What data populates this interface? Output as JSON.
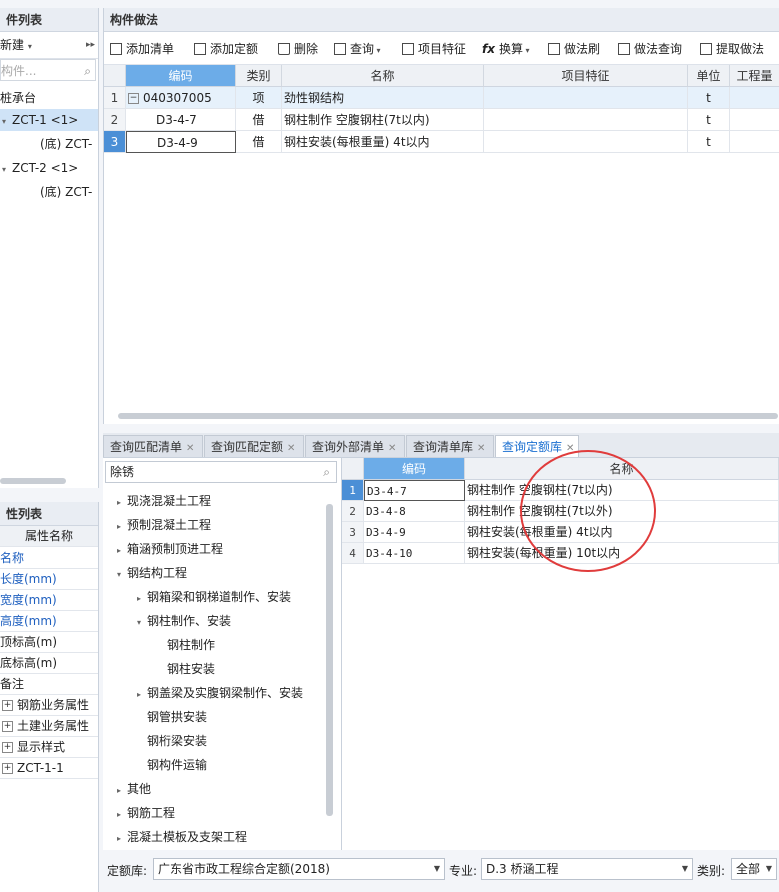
{
  "left_top": {
    "title": "件列表",
    "new_label": "新建",
    "search_placeholder": "构件...",
    "tree": [
      "桩承台",
      "ZCT-1 <1>",
      "(底) ZCT-",
      "ZCT-2 <1>",
      "(底) ZCT-"
    ]
  },
  "left_bottom": {
    "title": "性列表",
    "header": "属性名称",
    "rows": [
      {
        "label": "名称"
      },
      {
        "label": "长度(mm)"
      },
      {
        "label": "宽度(mm)"
      },
      {
        "label": "高度(mm)"
      },
      {
        "label": "顶标高(m)"
      },
      {
        "label": "底标高(m)"
      },
      {
        "label": "备注"
      },
      {
        "label": "钢筋业务属性"
      },
      {
        "label": "土建业务属性"
      },
      {
        "label": "显示样式"
      },
      {
        "label": "ZCT-1-1"
      }
    ]
  },
  "main": {
    "title": "构件做法",
    "toolbar": [
      "添加清单",
      "添加定额",
      "删除",
      "查询",
      "项目特征",
      "换算",
      "做法刷",
      "做法查询",
      "提取做法"
    ],
    "columns": [
      "编码",
      "类别",
      "名称",
      "项目特征",
      "单位",
      "工程量"
    ],
    "rows": [
      {
        "num": "1",
        "code": "040307005",
        "type": "项",
        "name": "劲性钢结构",
        "unit": "t"
      },
      {
        "num": "2",
        "code": "D3-4-7",
        "type": "借",
        "name": "钢柱制作 空腹钢柱(7t以内)",
        "unit": "t"
      },
      {
        "num": "3",
        "code": "D3-4-9",
        "type": "借",
        "name": "钢柱安装(每根重量) 4t以内",
        "unit": "t"
      }
    ]
  },
  "tabs": [
    "查询匹配清单",
    "查询匹配定额",
    "查询外部清单",
    "查询清单库",
    "查询定额库"
  ],
  "tree_panel": {
    "search_value": "除锈",
    "items": [
      "现浇混凝土工程",
      "预制混凝土工程",
      "箱涵预制顶进工程",
      "钢结构工程",
      "钢箱梁和钢梯道制作、安装",
      "钢柱制作、安装",
      "钢柱制作",
      "钢柱安装",
      "钢盖梁及实腹钢梁制作、安装",
      "钢管拱安装",
      "钢桁梁安装",
      "钢构件运输",
      "其他",
      "钢筋工程",
      "混凝土模板及支架工程"
    ]
  },
  "result": {
    "columns": [
      "编码",
      "名称"
    ],
    "rows": [
      {
        "num": "1",
        "code": "D3-4-7",
        "name": "钢柱制作 空腹钢柱(7t以内)"
      },
      {
        "num": "2",
        "code": "D3-4-8",
        "name": "钢柱制作 空腹钢柱(7t以外)"
      },
      {
        "num": "3",
        "code": "D3-4-9",
        "name": "钢柱安装(每根重量) 4t以内"
      },
      {
        "num": "4",
        "code": "D3-4-10",
        "name": "钢柱安装(每根重量) 10t以内"
      }
    ]
  },
  "bottom": {
    "quota_label": "定额库:",
    "quota_value": "广东省市政工程综合定额(2018)",
    "major_label": "专业:",
    "major_value": "D.3 桥涵工程",
    "category_label": "类别:",
    "category_value": "全部"
  },
  "colors": {
    "accent": "#6cace8",
    "selected_row": "#4b8fd6",
    "annotation": "#e03c3c"
  }
}
